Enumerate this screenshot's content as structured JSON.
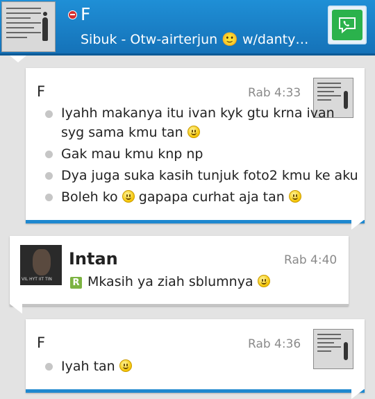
{
  "header": {
    "contact_name": "F",
    "status_text": "Sibuk - Otw-airterjun 🙂 w/danty,de...",
    "accent_color": "#1f8fd6",
    "call_icon": "chat-call-icon"
  },
  "messages": [
    {
      "sender": "F",
      "time": "Rab 4:33",
      "lines": [
        "Iyahh makanya itu ivan kyk gtu krna ivan syg sama kmu tan",
        "Gak mau kmu knp np",
        "Dya juga suka kasih tunjuk foto2 kmu ke aku",
        "Boleh ko",
        "gapapa curhat aja tan"
      ]
    },
    {
      "sender": "Intan",
      "time": "Rab 4:40",
      "badge": "R",
      "text": "Mkasih ya ziah sblumnya"
    },
    {
      "sender": "F",
      "time": "Rab 4:36",
      "lines": [
        "Iyah tan"
      ]
    }
  ]
}
